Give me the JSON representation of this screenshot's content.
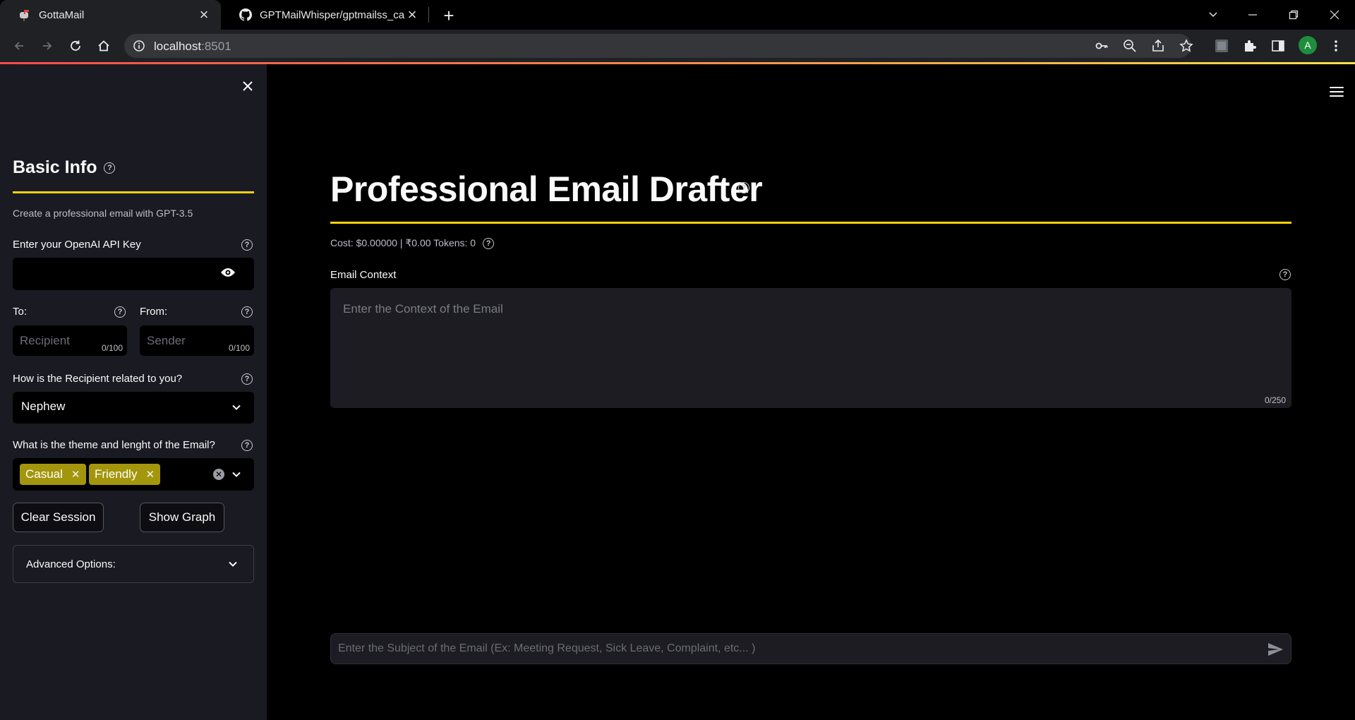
{
  "browser": {
    "tabs": [
      {
        "title": "GottaMail",
        "active": true
      },
      {
        "title": "GPTMailWhisper/gptmailss_can_c",
        "active": false
      }
    ],
    "url_host": "localhost",
    "url_port": ":8501",
    "profile_initial": "A"
  },
  "sidebar": {
    "title": "Basic Info",
    "caption": "Create a professional email with GPT-3.5",
    "api_key": {
      "label": "Enter your OpenAI API Key",
      "value": ""
    },
    "to": {
      "label": "To:",
      "placeholder": "Recipient",
      "count": "0/100"
    },
    "from": {
      "label": "From:",
      "placeholder": "Sender",
      "count": "0/100"
    },
    "relation": {
      "label": "How is the Recipient related to you?",
      "selected": "Nephew"
    },
    "theme": {
      "label": "What is the theme and lenght of the Email?",
      "chips": [
        "Casual",
        "Friendly"
      ]
    },
    "buttons": {
      "clear": "Clear Session",
      "graph": "Show Graph"
    },
    "advanced": "Advanced Options:"
  },
  "main": {
    "title": "Professional Email Drafter",
    "cost": "Cost: $0.00000 | ₹0.00 Tokens: 0",
    "context": {
      "label": "Email Context",
      "placeholder": "Enter the Context of the Email",
      "count": "0/250"
    },
    "subject_placeholder": "Enter the Subject of the Email (Ex: Meeting Request, Sick Leave, Complaint, etc... )"
  },
  "colors": {
    "accent_rule": "#f5d20a",
    "chip": "#a4960c",
    "sidebar_bg": "#1a1a22"
  }
}
